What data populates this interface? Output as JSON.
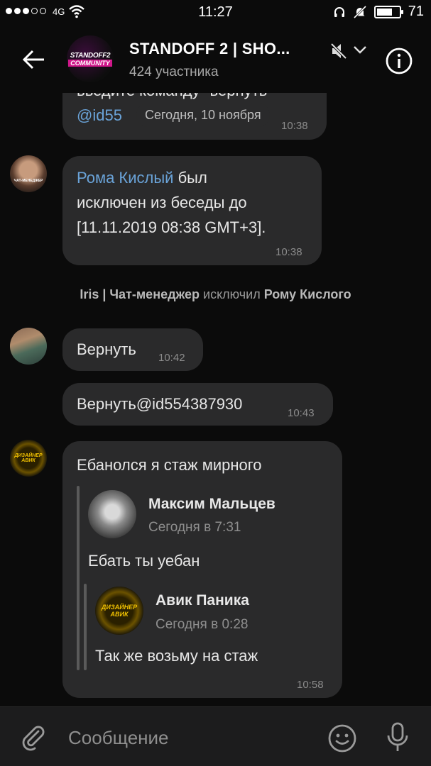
{
  "status": {
    "network": "4G",
    "time": "11:27",
    "battery": "71",
    "battery_level": 0.71
  },
  "header": {
    "avatar_line1": "STANDOFF2",
    "avatar_line2": "COMMUNITY",
    "title": "STANDOFF 2 | SHO...",
    "members": "424 участника"
  },
  "top_message": {
    "line1": "введите команду \"вернуть\"",
    "line2": "@id55",
    "time": "10:38"
  },
  "date_pill": "Сегодня, 10 ноября",
  "kick_message": {
    "avatar_text": "ЧАТ-МЕНЕДЖЕР",
    "name_link": "Рома Кислый",
    "text_1": " был",
    "line2": "исключен из беседы до",
    "line3": "[11.11.2019 08:38 GMT+3].",
    "time": "10:38"
  },
  "service": {
    "actor": "Iris | Чат-менеджер",
    "action": " исключил ",
    "target": "Рому Кислого"
  },
  "msg_return": {
    "text": "Вернуть",
    "time": "10:42"
  },
  "msg_return_id": {
    "text": "Вернуть@id554387930",
    "time": "10:43"
  },
  "msg_reply": {
    "avatar_line1": "ДИЗАЙНЕР",
    "avatar_line2": "АВИК",
    "text": "Ебанолся я стаж мирного",
    "time": "10:58",
    "forward1": {
      "name": "Максим Мальцев",
      "time": "Сегодня в 7:31",
      "text": "Ебать ты уебан"
    },
    "forward2": {
      "name": "Авик Паника",
      "time": "Сегодня в 0:28",
      "text": "Так же возьму на стаж",
      "avatar_line1": "ДИЗАЙНЕР",
      "avatar_line2": "АВИК"
    }
  },
  "input": {
    "placeholder": "Сообщение"
  }
}
